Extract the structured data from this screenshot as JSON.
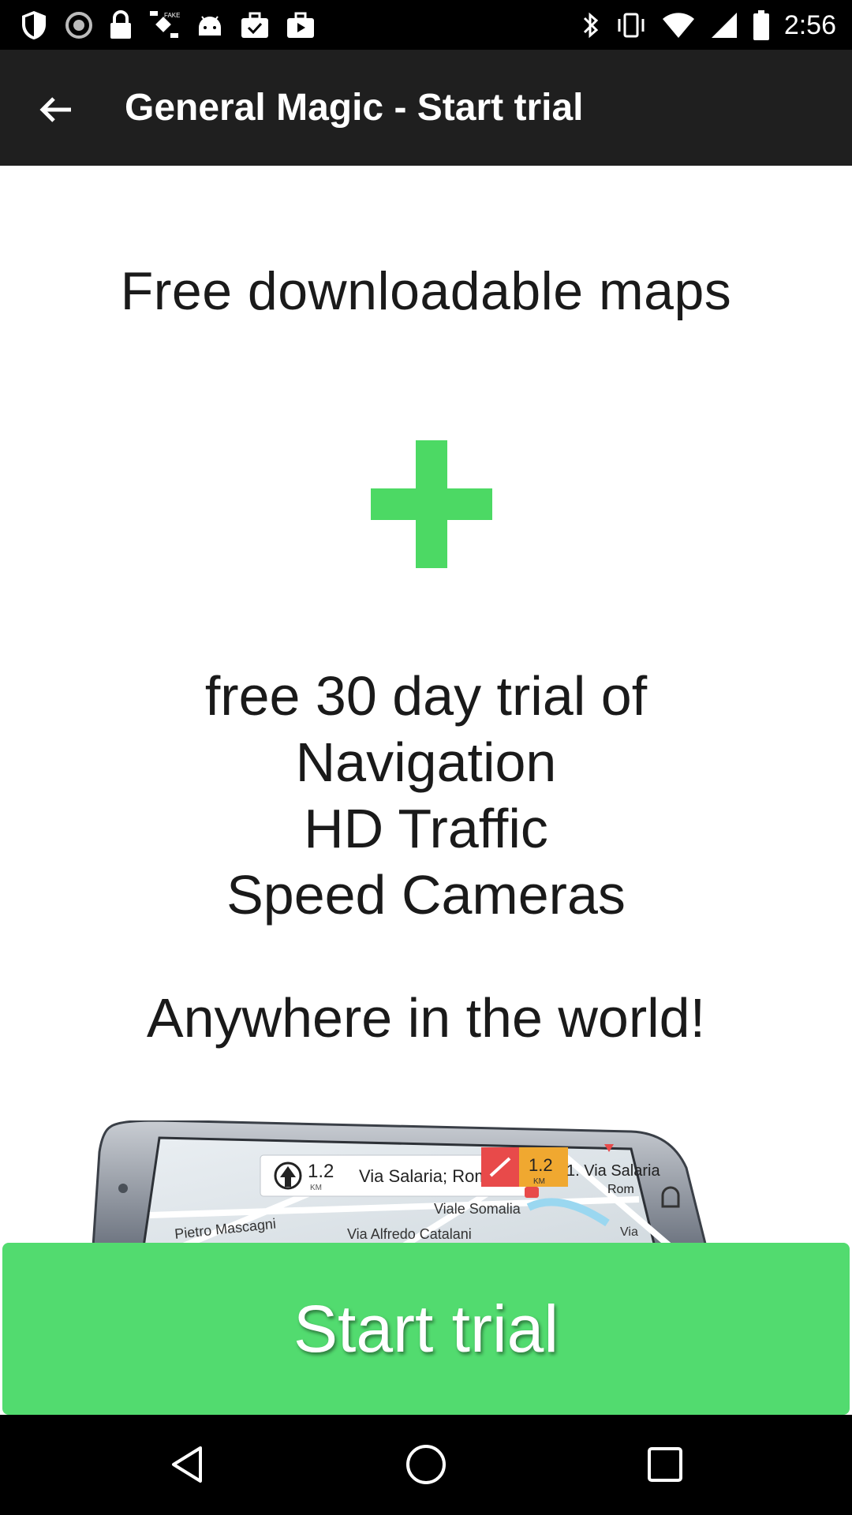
{
  "status_bar": {
    "time": "2:56",
    "left_icons": [
      "shield-icon",
      "blocked-icon",
      "lock-icon",
      "fake-gps-icon",
      "android-icon",
      "briefcase-check-icon",
      "play-store-icon"
    ],
    "right_icons": [
      "bluetooth-icon",
      "vibrate-icon",
      "wifi-icon",
      "signal-icon",
      "battery-icon"
    ]
  },
  "app_bar": {
    "title": "General Magic - Start trial",
    "back_icon": "arrow-back-icon"
  },
  "content": {
    "headline": "Free downloadable maps",
    "plus_color": "#4cd964",
    "features": [
      "free 30 day trial of",
      "Navigation",
      "HD Traffic",
      "Speed Cameras"
    ],
    "tagline": "Anywhere in the world!",
    "phone_preview": {
      "distance_1": "1.2",
      "unit": "KM",
      "street": "Via Salaria; Rome",
      "distance_2": "1.2",
      "side_label": "1. Via Salaria",
      "side_sub": "Rom",
      "street_2": "Viale Somalia",
      "street_3": "Via Alfredo Catalani",
      "street_4": "Pietro Mascagni",
      "street_5": "Via"
    }
  },
  "cta": {
    "label": "Start trial",
    "color": "#52db6f"
  },
  "nav_bar": {
    "icons": [
      "back-triangle-icon",
      "home-circle-icon",
      "recents-square-icon"
    ]
  }
}
